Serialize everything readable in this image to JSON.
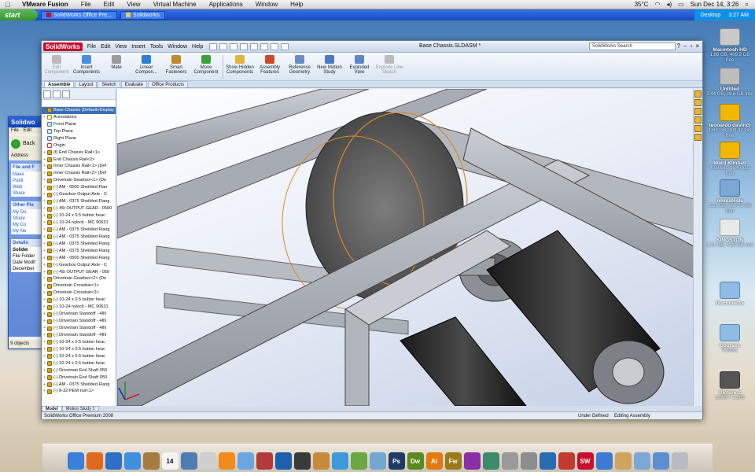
{
  "mac_menubar": {
    "app": "VMware Fusion",
    "items": [
      "File",
      "Edit",
      "View",
      "Virtual Machine",
      "Applications",
      "Window",
      "Help"
    ],
    "temperature": "35°C",
    "datetime": "Sun Dec 14, 3:26"
  },
  "xp_taskbar": {
    "start": "start",
    "tasks": [
      "SolidWorks Office Pre...",
      "Solidworks"
    ],
    "desktop": "Desktop",
    "clock": "3:27 AM"
  },
  "explorer": {
    "title": "Solidwo",
    "menu": [
      "File",
      "Edit"
    ],
    "back": "Back",
    "address": "Address",
    "panels": [
      {
        "header": "File and F",
        "items": [
          "Make",
          "Publi",
          "Web",
          "Share"
        ]
      },
      {
        "header": "Other Pla",
        "items": [
          "My Do",
          "Share",
          "My Co",
          "My Ne"
        ]
      },
      {
        "header": "Details",
        "items": [
          "Solidw",
          "File Folder",
          "Date Modif",
          "December"
        ]
      }
    ],
    "status": "9 objects"
  },
  "solidworks": {
    "logo": "SolidWorks",
    "menus": [
      "File",
      "Edit",
      "View",
      "Insert",
      "Tools",
      "Window",
      "Help"
    ],
    "doc_title": "Base Chassis.SLDASM *",
    "search": "SolidWorks Search",
    "commands": [
      {
        "label": "Edit Component",
        "color": "#bbbbbb",
        "dim": true
      },
      {
        "label": "Insert Components",
        "color": "#4a8de0",
        "dim": false
      },
      {
        "label": "Mate",
        "color": "#9b9b9b",
        "dim": false
      },
      {
        "label": "Linear Compon...",
        "color": "#2f7dcf",
        "dim": false
      },
      {
        "label": "Smart Fasteners",
        "color": "#c08a2e",
        "dim": false
      },
      {
        "label": "Move Component",
        "color": "#3aa23a",
        "dim": false
      },
      {
        "label": "Show Hidden Components",
        "color": "#e2b33e",
        "dim": false
      },
      {
        "label": "Assembly Features",
        "color": "#c84a2a",
        "dim": false
      },
      {
        "label": "Reference Geometry",
        "color": "#6b8bc2",
        "dim": false
      },
      {
        "label": "New Motion Study",
        "color": "#4c78c4",
        "dim": false
      },
      {
        "label": "Exploded View",
        "color": "#5f86c7",
        "dim": false
      },
      {
        "label": "Explode Line Sketch",
        "color": "#bbbbbb",
        "dim": true
      }
    ],
    "cmd_tabs": [
      "Assemble",
      "Layout",
      "Sketch",
      "Evaluate",
      "Office Products"
    ],
    "tree": [
      {
        "label": "Base Chassis (Default<Display",
        "icon": "asm",
        "root": true
      },
      {
        "label": "Annotations",
        "icon": "ann",
        "plus": "+"
      },
      {
        "label": "Front Plane",
        "icon": "plane"
      },
      {
        "label": "Top Plane",
        "icon": "plane"
      },
      {
        "label": "Right Plane",
        "icon": "plane"
      },
      {
        "label": "Origin",
        "icon": "org"
      },
      {
        "label": "(f) End Chassis Rail<1>",
        "plus": "+"
      },
      {
        "label": "End Chassis Rail<2>",
        "plus": "+"
      },
      {
        "label": "Inner Chassis Rail<1> (Def",
        "plus": "+"
      },
      {
        "label": "Inner Chassis Rail<2> (Def",
        "plus": "+"
      },
      {
        "label": "Drivetrain Gearbox<1> (De",
        "plus": "+"
      },
      {
        "label": "(-) AM - 0500 Sheilded Flan",
        "plus": "+"
      },
      {
        "label": "(-) Gearbox Output Axle - C",
        "plus": "+"
      },
      {
        "label": "(-) AM - 0375 Sheilded Flang",
        "plus": "+"
      },
      {
        "label": "(-) 45t OUTPUT GEAR - 0500",
        "plus": "+"
      },
      {
        "label": "(-) 10-24 x 0.5 button heac",
        "plus": "+"
      },
      {
        "label": "(-) 10-24 nylock - MC 90631",
        "plus": "+"
      },
      {
        "label": "(-) AM - 0375 Sheilded Flang",
        "plus": "+"
      },
      {
        "label": "(-) AM - 0375 Sheilded Flang",
        "plus": "+"
      },
      {
        "label": "(-) AM - 0375 Sheilded Flang",
        "plus": "+"
      },
      {
        "label": "(-) AM - 0375 Sheilded Flang",
        "plus": "+"
      },
      {
        "label": "(-) AM - 0500 Sheilded Flang",
        "plus": "+"
      },
      {
        "label": "(-) Gearbox Output Axle - C",
        "plus": "+"
      },
      {
        "label": "(-) 45t OUTPUT GEAR - 050",
        "plus": "+"
      },
      {
        "label": "Drivetrain Gearbox<2> (De",
        "plus": "+"
      },
      {
        "label": "Drivetrain Crossbar<1>",
        "plus": "+"
      },
      {
        "label": "Drivetrain Crossbar<2>",
        "plus": "+"
      },
      {
        "label": "(-) 10-24 x 0.5 button heac",
        "plus": "+"
      },
      {
        "label": "(-) 10-24 nylock - MC 90631",
        "plus": "+"
      },
      {
        "label": "(-) Drivetrain Standoff - 4IN",
        "plus": "+"
      },
      {
        "label": "(-) Drivetrain Standoff - 4IN",
        "plus": "+"
      },
      {
        "label": "(-) Drivetrain Standoff - 4IN",
        "plus": "+"
      },
      {
        "label": "(-) Drivetrain Standoff - 4IN",
        "plus": "+"
      },
      {
        "label": "(-) 10-24 x 0.5 button heac",
        "plus": "+"
      },
      {
        "label": "(-) 10-24 x 0.5 button heac",
        "plus": "+"
      },
      {
        "label": "(-) 10-24 x 0.5 button heac",
        "plus": "+"
      },
      {
        "label": "(-) 10-24 x 0.5 button heac",
        "plus": "+"
      },
      {
        "label": "(-) Drivetrain End Shaft 050",
        "plus": "+"
      },
      {
        "label": "(-) Drivetrain End Shaft 050",
        "plus": "+"
      },
      {
        "label": "(-) AM - 0375 Sheilded Flang",
        "plus": "+"
      },
      {
        "label": "(-) 8-32 PEM nut<1>",
        "plus": "+"
      }
    ],
    "bottom_tabs": [
      "Model",
      "Motion Study 1"
    ],
    "status": {
      "left": "SolidWorks Office Premium 2008",
      "state": "Under Defined",
      "mode": "Editing Assembly"
    }
  },
  "desktop_icons": [
    {
      "name": "Macintosh HD",
      "info": "1.88 GB, 409.2 GB free",
      "color": "#c9c9c9"
    },
    {
      "name": "Untitled",
      "info": "2.44 GB, 29.8 GB free",
      "color": "#bdbdbd"
    },
    {
      "name": "leonardo daVinci",
      "info": "1.63 GB, 309.42 GB free",
      "color": "#f2b705"
    },
    {
      "name": "Ward Kimball",
      "info": "4.09 GB, 96.47 GB free",
      "color": "#f2b705"
    },
    {
      "name": "nikolatesla",
      "info": "1.51 GB, 660.71 GB free",
      "color": "#7aa7d6"
    },
    {
      "name": "KINGSTON",
      "info": "1.91 GB, 4.28 GB free",
      "color": "#e9e9e9"
    },
    {
      "name": "Documents",
      "info": "",
      "color": "#8ebce6"
    },
    {
      "name": "Courses",
      "info": "9 items",
      "color": "#8ebce6"
    },
    {
      "name": "Picture 2",
      "info": "1,600 × 1,200",
      "color": "#555555"
    }
  ],
  "dock": [
    {
      "name": "finder",
      "color": "#3b7fd8",
      "label": ""
    },
    {
      "name": "firefox",
      "color": "#e06a1b",
      "label": ""
    },
    {
      "name": "network",
      "color": "#2f6fc8",
      "label": ""
    },
    {
      "name": "ichat",
      "color": "#3f8fe0",
      "label": ""
    },
    {
      "name": "address-book",
      "color": "#a57b42",
      "label": ""
    },
    {
      "name": "ical",
      "color": "#f4f4f4",
      "label": "14"
    },
    {
      "name": "iphoto",
      "color": "#4d7db4",
      "label": ""
    },
    {
      "name": "preview",
      "color": "#cfcfcf",
      "label": ""
    },
    {
      "name": "vlc",
      "color": "#f18b1a",
      "label": ""
    },
    {
      "name": "itunes",
      "color": "#6aa6e2",
      "label": ""
    },
    {
      "name": "photo-booth",
      "color": "#b43a3a",
      "label": ""
    },
    {
      "name": "quicktime",
      "color": "#1f5fb0",
      "label": ""
    },
    {
      "name": "imovie",
      "color": "#3a3a3a",
      "label": ""
    },
    {
      "name": "garageband",
      "color": "#c58a3c",
      "label": ""
    },
    {
      "name": "iweb",
      "color": "#3c9bd8",
      "label": ""
    },
    {
      "name": "vmware",
      "color": "#69a842",
      "label": ""
    },
    {
      "name": "mirror",
      "color": "#74a7d0",
      "label": ""
    },
    {
      "name": "photoshop",
      "color": "#1f3b62",
      "label": "Ps"
    },
    {
      "name": "dreamweaver",
      "color": "#5a8a1f",
      "label": "Dw"
    },
    {
      "name": "illustrator",
      "color": "#e27a11",
      "label": "Ai"
    },
    {
      "name": "fireworks",
      "color": "#9a7a16",
      "label": "Fw"
    },
    {
      "name": "istat",
      "color": "#8a2fa8",
      "label": ""
    },
    {
      "name": "time-machine",
      "color": "#3b8a6a",
      "label": ""
    },
    {
      "name": "utilities",
      "color": "#9a9a9a",
      "label": ""
    },
    {
      "name": "disk-utility",
      "color": "#8d8d8d",
      "label": ""
    },
    {
      "name": "virtualbox",
      "color": "#2a6ab0",
      "label": ""
    },
    {
      "name": "parallels",
      "color": "#c33a2f",
      "label": ""
    },
    {
      "name": "solidworks",
      "color": "#c8102e",
      "label": "SW"
    },
    {
      "name": "windows",
      "color": "#3c7bd1",
      "label": ""
    },
    {
      "name": "docs-stack",
      "color": "#d2a35f",
      "label": ""
    },
    {
      "name": "app-stack",
      "color": "#7aa7d6",
      "label": ""
    },
    {
      "name": "downloads-stack",
      "color": "#5c8fd1",
      "label": ""
    },
    {
      "name": "trash",
      "color": "#b8bcc2",
      "label": ""
    }
  ]
}
